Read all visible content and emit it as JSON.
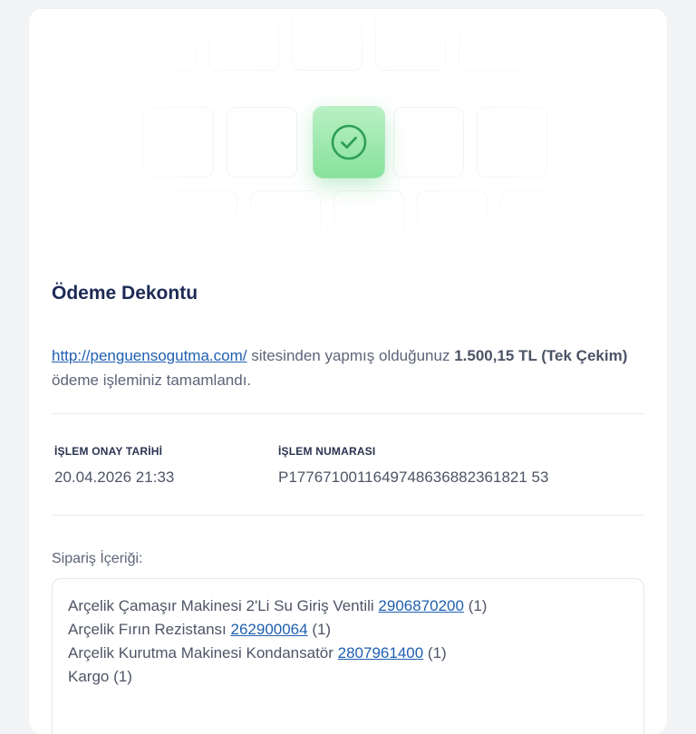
{
  "receipt": {
    "title": "Ödeme Dekontu",
    "summary": {
      "site_link": "http://penguensogutma.com/",
      "text_before_amount": " sitesinden yapmış olduğunuz ",
      "amount": "1.500,15 TL (Tek Çekim)",
      "text_after_amount": " ödeme işleminiz tamamlandı."
    },
    "details": {
      "approval_date_label": "İŞLEM ONAY TARİHİ",
      "approval_date_value": "20.04.2026 21:33",
      "transaction_number_label": "İŞLEM NUMARASI",
      "transaction_number_value": "P1776710011649748636882361821 53"
    },
    "order": {
      "label": "Sipariş İçeriği:",
      "items": [
        {
          "name": "Arçelik Çamaşır Makinesi 2'Li Su Giriş Ventili ",
          "code": "2906870200",
          "qty": " (1)"
        },
        {
          "name": "Arçelik Fırın Rezistansı ",
          "code": "262900064",
          "qty": " (1)"
        },
        {
          "name": "Arçelik Kurutma Makinesi Kondansatör ",
          "code": "2807961400",
          "qty": " (1)"
        },
        {
          "name": "Kargo (1)",
          "code": "",
          "qty": ""
        }
      ]
    }
  },
  "colors": {
    "title": "#1d2a56",
    "link": "#1f5fb0",
    "success": "#86e29a",
    "check": "#2e9e55"
  },
  "icons": {
    "success": "check-circle-icon"
  }
}
